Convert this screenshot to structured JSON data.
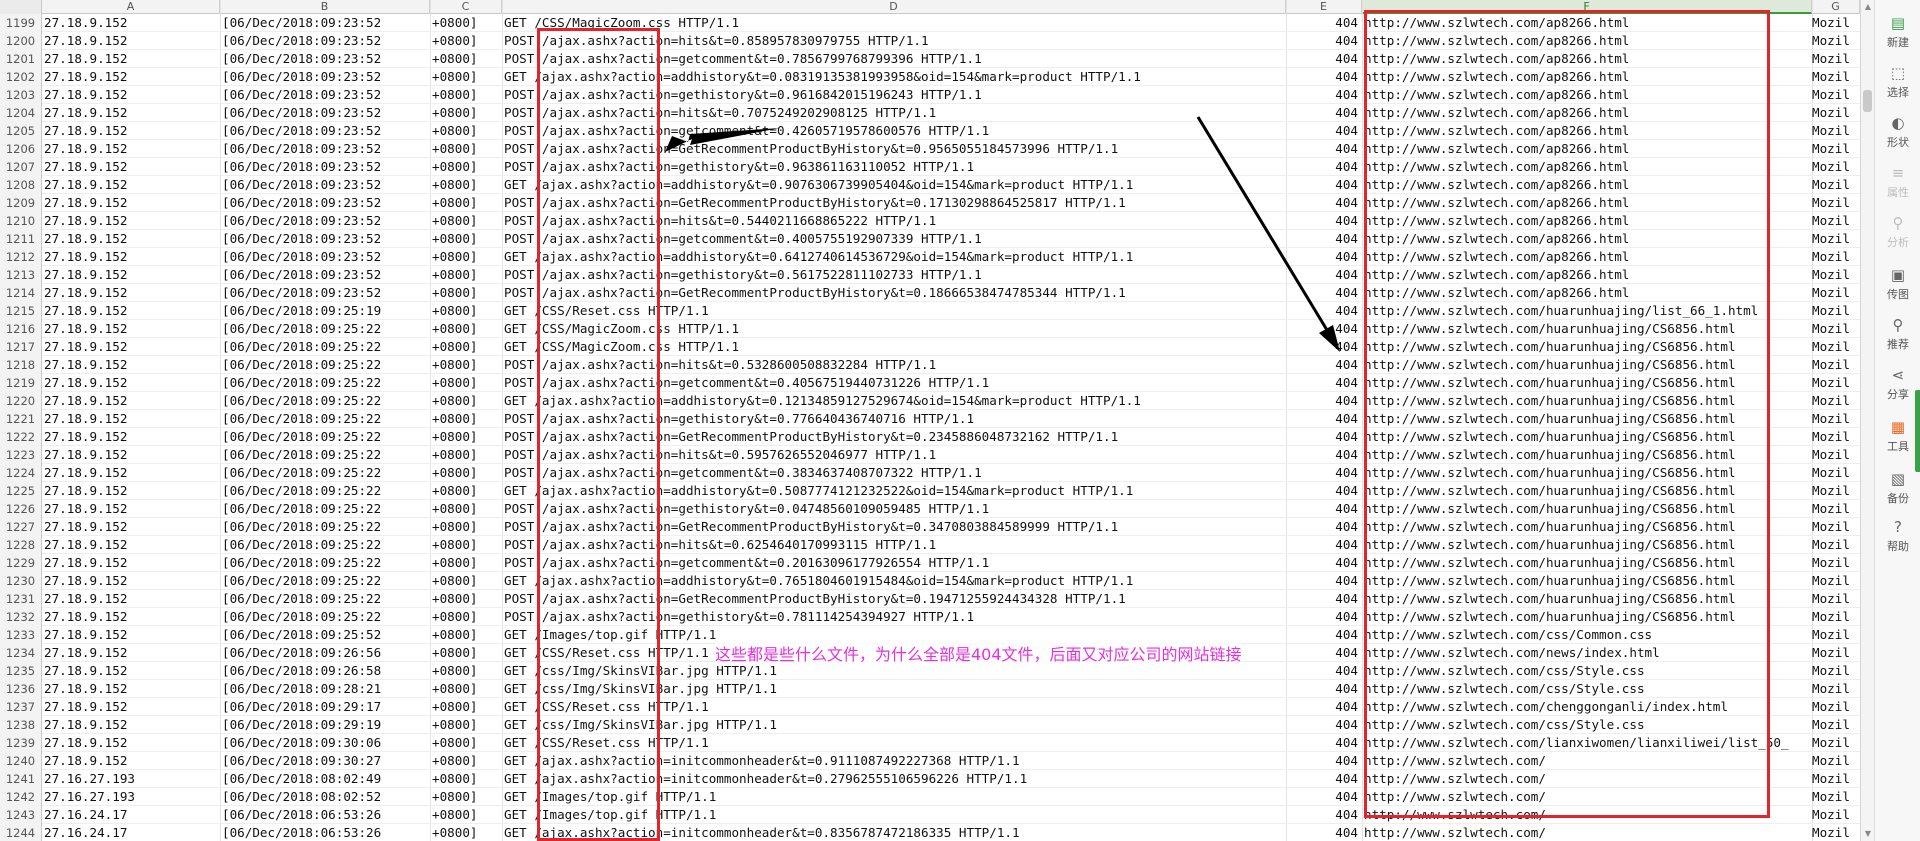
{
  "columns": [
    "A",
    "B",
    "C",
    "D",
    "E",
    "F",
    "G"
  ],
  "rows": [
    {
      "n": "1199",
      "a": "27.18.9.152",
      "b": "[06/Dec/2018:09:23:52",
      "c": "+0800]",
      "d": "GET /CSS/MagicZoom.css HTTP/1.1",
      "e": "404",
      "f": "http://www.szlwtech.com/ap8266.html",
      "g": "Mozil"
    },
    {
      "n": "1200",
      "a": "27.18.9.152",
      "b": "[06/Dec/2018:09:23:52",
      "c": "+0800]",
      "d": "POST /ajax.ashx?action=hits&t=0.858957830979755 HTTP/1.1",
      "e": "404",
      "f": "http://www.szlwtech.com/ap8266.html",
      "g": "Mozil"
    },
    {
      "n": "1201",
      "a": "27.18.9.152",
      "b": "[06/Dec/2018:09:23:52",
      "c": "+0800]",
      "d": "POST /ajax.ashx?action=getcomment&t=0.7856799768799396 HTTP/1.1",
      "e": "404",
      "f": "http://www.szlwtech.com/ap8266.html",
      "g": "Mozil"
    },
    {
      "n": "1202",
      "a": "27.18.9.152",
      "b": "[06/Dec/2018:09:23:52",
      "c": "+0800]",
      "d": "GET /ajax.ashx?action=addhistory&t=0.08319135381993958&oid=154&mark=product HTTP/1.1",
      "e": "404",
      "f": "http://www.szlwtech.com/ap8266.html",
      "g": "Mozil"
    },
    {
      "n": "1203",
      "a": "27.18.9.152",
      "b": "[06/Dec/2018:09:23:52",
      "c": "+0800]",
      "d": "POST /ajax.ashx?action=gethistory&t=0.9616842015196243 HTTP/1.1",
      "e": "404",
      "f": "http://www.szlwtech.com/ap8266.html",
      "g": "Mozil"
    },
    {
      "n": "1204",
      "a": "27.18.9.152",
      "b": "[06/Dec/2018:09:23:52",
      "c": "+0800]",
      "d": "POST /ajax.ashx?action=hits&t=0.7075249202908125 HTTP/1.1",
      "e": "404",
      "f": "http://www.szlwtech.com/ap8266.html",
      "g": "Mozil"
    },
    {
      "n": "1205",
      "a": "27.18.9.152",
      "b": "[06/Dec/2018:09:23:52",
      "c": "+0800]",
      "d": "POST /ajax.ashx?action=getcomment&t=0.42605719578600576 HTTP/1.1",
      "e": "404",
      "f": "http://www.szlwtech.com/ap8266.html",
      "g": "Mozil"
    },
    {
      "n": "1206",
      "a": "27.18.9.152",
      "b": "[06/Dec/2018:09:23:52",
      "c": "+0800]",
      "d": "POST /ajax.ashx?action=GetRecommentProductByHistory&t=0.9565055184573996 HTTP/1.1",
      "e": "404",
      "f": "http://www.szlwtech.com/ap8266.html",
      "g": "Mozil"
    },
    {
      "n": "1207",
      "a": "27.18.9.152",
      "b": "[06/Dec/2018:09:23:52",
      "c": "+0800]",
      "d": "POST /ajax.ashx?action=gethistory&t=0.963861163110052 HTTP/1.1",
      "e": "404",
      "f": "http://www.szlwtech.com/ap8266.html",
      "g": "Mozil"
    },
    {
      "n": "1208",
      "a": "27.18.9.152",
      "b": "[06/Dec/2018:09:23:52",
      "c": "+0800]",
      "d": "GET /ajax.ashx?action=addhistory&t=0.9076306739905404&oid=154&mark=product HTTP/1.1",
      "e": "404",
      "f": "http://www.szlwtech.com/ap8266.html",
      "g": "Mozil"
    },
    {
      "n": "1209",
      "a": "27.18.9.152",
      "b": "[06/Dec/2018:09:23:52",
      "c": "+0800]",
      "d": "POST /ajax.ashx?action=GetRecommentProductByHistory&t=0.17130298864525817 HTTP/1.1",
      "e": "404",
      "f": "http://www.szlwtech.com/ap8266.html",
      "g": "Mozil"
    },
    {
      "n": "1210",
      "a": "27.18.9.152",
      "b": "[06/Dec/2018:09:23:52",
      "c": "+0800]",
      "d": "POST /ajax.ashx?action=hits&t=0.5440211668865222 HTTP/1.1",
      "e": "404",
      "f": "http://www.szlwtech.com/ap8266.html",
      "g": "Mozil"
    },
    {
      "n": "1211",
      "a": "27.18.9.152",
      "b": "[06/Dec/2018:09:23:52",
      "c": "+0800]",
      "d": "POST /ajax.ashx?action=getcomment&t=0.4005755192907339 HTTP/1.1",
      "e": "404",
      "f": "http://www.szlwtech.com/ap8266.html",
      "g": "Mozil"
    },
    {
      "n": "1212",
      "a": "27.18.9.152",
      "b": "[06/Dec/2018:09:23:52",
      "c": "+0800]",
      "d": "GET /ajax.ashx?action=addhistory&t=0.6412740614536729&oid=154&mark=product HTTP/1.1",
      "e": "404",
      "f": "http://www.szlwtech.com/ap8266.html",
      "g": "Mozil"
    },
    {
      "n": "1213",
      "a": "27.18.9.152",
      "b": "[06/Dec/2018:09:23:52",
      "c": "+0800]",
      "d": "POST /ajax.ashx?action=gethistory&t=0.5617522811102733 HTTP/1.1",
      "e": "404",
      "f": "http://www.szlwtech.com/ap8266.html",
      "g": "Mozil"
    },
    {
      "n": "1214",
      "a": "27.18.9.152",
      "b": "[06/Dec/2018:09:23:52",
      "c": "+0800]",
      "d": "POST /ajax.ashx?action=GetRecommentProductByHistory&t=0.18666538474785344 HTTP/1.1",
      "e": "404",
      "f": "http://www.szlwtech.com/ap8266.html",
      "g": "Mozil"
    },
    {
      "n": "1215",
      "a": "27.18.9.152",
      "b": "[06/Dec/2018:09:25:19",
      "c": "+0800]",
      "d": "GET /CSS/Reset.css HTTP/1.1",
      "e": "404",
      "f": "http://www.szlwtech.com/huarunhuajing/list_66_1.html",
      "g": "Mozil"
    },
    {
      "n": "1216",
      "a": "27.18.9.152",
      "b": "[06/Dec/2018:09:25:22",
      "c": "+0800]",
      "d": "GET /CSS/MagicZoom.css HTTP/1.1",
      "e": "404",
      "f": "http://www.szlwtech.com/huarunhuajing/CS6856.html",
      "g": "Mozil"
    },
    {
      "n": "1217",
      "a": "27.18.9.152",
      "b": "[06/Dec/2018:09:25:22",
      "c": "+0800]",
      "d": "GET /CSS/MagicZoom.css HTTP/1.1",
      "e": "404",
      "f": "http://www.szlwtech.com/huarunhuajing/CS6856.html",
      "g": "Mozil"
    },
    {
      "n": "1218",
      "a": "27.18.9.152",
      "b": "[06/Dec/2018:09:25:22",
      "c": "+0800]",
      "d": "POST /ajax.ashx?action=hits&t=0.5328600508832284 HTTP/1.1",
      "e": "404",
      "f": "http://www.szlwtech.com/huarunhuajing/CS6856.html",
      "g": "Mozil"
    },
    {
      "n": "1219",
      "a": "27.18.9.152",
      "b": "[06/Dec/2018:09:25:22",
      "c": "+0800]",
      "d": "POST /ajax.ashx?action=getcomment&t=0.40567519440731226 HTTP/1.1",
      "e": "404",
      "f": "http://www.szlwtech.com/huarunhuajing/CS6856.html",
      "g": "Mozil"
    },
    {
      "n": "1220",
      "a": "27.18.9.152",
      "b": "[06/Dec/2018:09:25:22",
      "c": "+0800]",
      "d": "GET /ajax.ashx?action=addhistory&t=0.12134859127529674&oid=154&mark=product HTTP/1.1",
      "e": "404",
      "f": "http://www.szlwtech.com/huarunhuajing/CS6856.html",
      "g": "Mozil"
    },
    {
      "n": "1221",
      "a": "27.18.9.152",
      "b": "[06/Dec/2018:09:25:22",
      "c": "+0800]",
      "d": "POST /ajax.ashx?action=gethistory&t=0.776640436740716 HTTP/1.1",
      "e": "404",
      "f": "http://www.szlwtech.com/huarunhuajing/CS6856.html",
      "g": "Mozil"
    },
    {
      "n": "1222",
      "a": "27.18.9.152",
      "b": "[06/Dec/2018:09:25:22",
      "c": "+0800]",
      "d": "POST /ajax.ashx?action=GetRecommentProductByHistory&t=0.2345886048732162 HTTP/1.1",
      "e": "404",
      "f": "http://www.szlwtech.com/huarunhuajing/CS6856.html",
      "g": "Mozil"
    },
    {
      "n": "1223",
      "a": "27.18.9.152",
      "b": "[06/Dec/2018:09:25:22",
      "c": "+0800]",
      "d": "POST /ajax.ashx?action=hits&t=0.5957626552046977 HTTP/1.1",
      "e": "404",
      "f": "http://www.szlwtech.com/huarunhuajing/CS6856.html",
      "g": "Mozil"
    },
    {
      "n": "1224",
      "a": "27.18.9.152",
      "b": "[06/Dec/2018:09:25:22",
      "c": "+0800]",
      "d": "POST /ajax.ashx?action=getcomment&t=0.3834637408707322 HTTP/1.1",
      "e": "404",
      "f": "http://www.szlwtech.com/huarunhuajing/CS6856.html",
      "g": "Mozil"
    },
    {
      "n": "1225",
      "a": "27.18.9.152",
      "b": "[06/Dec/2018:09:25:22",
      "c": "+0800]",
      "d": "GET /ajax.ashx?action=addhistory&t=0.5087774121232522&oid=154&mark=product HTTP/1.1",
      "e": "404",
      "f": "http://www.szlwtech.com/huarunhuajing/CS6856.html",
      "g": "Mozil"
    },
    {
      "n": "1226",
      "a": "27.18.9.152",
      "b": "[06/Dec/2018:09:25:22",
      "c": "+0800]",
      "d": "POST /ajax.ashx?action=gethistory&t=0.04748560109059485 HTTP/1.1",
      "e": "404",
      "f": "http://www.szlwtech.com/huarunhuajing/CS6856.html",
      "g": "Mozil"
    },
    {
      "n": "1227",
      "a": "27.18.9.152",
      "b": "[06/Dec/2018:09:25:22",
      "c": "+0800]",
      "d": "POST /ajax.ashx?action=GetRecommentProductByHistory&t=0.3470803884589999 HTTP/1.1",
      "e": "404",
      "f": "http://www.szlwtech.com/huarunhuajing/CS6856.html",
      "g": "Mozil"
    },
    {
      "n": "1228",
      "a": "27.18.9.152",
      "b": "[06/Dec/2018:09:25:22",
      "c": "+0800]",
      "d": "POST /ajax.ashx?action=hits&t=0.6254640170993115 HTTP/1.1",
      "e": "404",
      "f": "http://www.szlwtech.com/huarunhuajing/CS6856.html",
      "g": "Mozil"
    },
    {
      "n": "1229",
      "a": "27.18.9.152",
      "b": "[06/Dec/2018:09:25:22",
      "c": "+0800]",
      "d": "POST /ajax.ashx?action=getcomment&t=0.20163096177926554 HTTP/1.1",
      "e": "404",
      "f": "http://www.szlwtech.com/huarunhuajing/CS6856.html",
      "g": "Mozil"
    },
    {
      "n": "1230",
      "a": "27.18.9.152",
      "b": "[06/Dec/2018:09:25:22",
      "c": "+0800]",
      "d": "GET /ajax.ashx?action=addhistory&t=0.7651804601915484&oid=154&mark=product HTTP/1.1",
      "e": "404",
      "f": "http://www.szlwtech.com/huarunhuajing/CS6856.html",
      "g": "Mozil"
    },
    {
      "n": "1231",
      "a": "27.18.9.152",
      "b": "[06/Dec/2018:09:25:22",
      "c": "+0800]",
      "d": "POST /ajax.ashx?action=GetRecommentProductByHistory&t=0.19471255924434328 HTTP/1.1",
      "e": "404",
      "f": "http://www.szlwtech.com/huarunhuajing/CS6856.html",
      "g": "Mozil"
    },
    {
      "n": "1232",
      "a": "27.18.9.152",
      "b": "[06/Dec/2018:09:25:22",
      "c": "+0800]",
      "d": "POST /ajax.ashx?action=gethistory&t=0.781114254394927 HTTP/1.1",
      "e": "404",
      "f": "http://www.szlwtech.com/huarunhuajing/CS6856.html",
      "g": "Mozil"
    },
    {
      "n": "1233",
      "a": "27.18.9.152",
      "b": "[06/Dec/2018:09:25:52",
      "c": "+0800]",
      "d": "GET /Images/top.gif HTTP/1.1",
      "e": "404",
      "f": "http://www.szlwtech.com/css/Common.css",
      "g": "Mozil"
    },
    {
      "n": "1234",
      "a": "27.18.9.152",
      "b": "[06/Dec/2018:09:26:56",
      "c": "+0800]",
      "d": "GET /CSS/Reset.css HTTP/1.1",
      "e": "404",
      "f": "http://www.szlwtech.com/news/index.html",
      "g": "Mozil"
    },
    {
      "n": "1235",
      "a": "27.18.9.152",
      "b": "[06/Dec/2018:09:26:58",
      "c": "+0800]",
      "d": "GET /css/Img/SkinsVIBar.jpg HTTP/1.1",
      "e": "404",
      "f": "http://www.szlwtech.com/css/Style.css",
      "g": "Mozil"
    },
    {
      "n": "1236",
      "a": "27.18.9.152",
      "b": "[06/Dec/2018:09:28:21",
      "c": "+0800]",
      "d": "GET /css/Img/SkinsVIBar.jpg HTTP/1.1",
      "e": "404",
      "f": "http://www.szlwtech.com/css/Style.css",
      "g": "Mozil"
    },
    {
      "n": "1237",
      "a": "27.18.9.152",
      "b": "[06/Dec/2018:09:29:17",
      "c": "+0800]",
      "d": "GET /CSS/Reset.css HTTP/1.1",
      "e": "404",
      "f": "http://www.szlwtech.com/chenggonganli/index.html",
      "g": "Mozil"
    },
    {
      "n": "1238",
      "a": "27.18.9.152",
      "b": "[06/Dec/2018:09:29:19",
      "c": "+0800]",
      "d": "GET /css/Img/SkinsVIBar.jpg HTTP/1.1",
      "e": "404",
      "f": "http://www.szlwtech.com/css/Style.css",
      "g": "Mozil"
    },
    {
      "n": "1239",
      "a": "27.18.9.152",
      "b": "[06/Dec/2018:09:30:06",
      "c": "+0800]",
      "d": "GET /CSS/Reset.css HTTP/1.1",
      "e": "404",
      "f": "http://www.szlwtech.com/lianxiwomen/lianxiliwei/list_50_",
      "g": "Mozil"
    },
    {
      "n": "1240",
      "a": "27.18.9.152",
      "b": "[06/Dec/2018:09:30:27",
      "c": "+0800]",
      "d": "GET /ajax.ashx?action=initcommonheader&t=0.9111087492227368 HTTP/1.1",
      "e": "404",
      "f": "http://www.szlwtech.com/",
      "g": "Mozil"
    },
    {
      "n": "1241",
      "a": "27.16.27.193",
      "b": "[06/Dec/2018:08:02:49",
      "c": "+0800]",
      "d": "GET /ajax.ashx?action=initcommonheader&t=0.27962555106596226 HTTP/1.1",
      "e": "404",
      "f": "http://www.szlwtech.com/",
      "g": "Mozil"
    },
    {
      "n": "1242",
      "a": "27.16.27.193",
      "b": "[06/Dec/2018:08:02:52",
      "c": "+0800]",
      "d": "GET /Images/top.gif HTTP/1.1",
      "e": "404",
      "f": "http://www.szlwtech.com/",
      "g": "Mozil"
    },
    {
      "n": "1243",
      "a": "27.16.24.17",
      "b": "[06/Dec/2018:06:53:26",
      "c": "+0800]",
      "d": "GET /Images/top.gif HTTP/1.1",
      "e": "404",
      "f": "http://www.szlwtech.com/",
      "g": "Mozil"
    },
    {
      "n": "1244",
      "a": "27.16.24.17",
      "b": "[06/Dec/2018:06:53:26",
      "c": "+0800]",
      "d": "GET /ajax.ashx?action=initcommonheader&t=0.8356787472186335 HTTP/1.1",
      "e": "404",
      "f": "http://www.szlwtech.com/",
      "g": "Mozil"
    }
  ],
  "annotation": "这些都是些什么文件，为什么全部是404文件，后面又对应公司的网站链接",
  "annotation_color": "#e52fe0",
  "highlight_color": "#e0262c",
  "sidebar": [
    {
      "icon": "new-doc-icon",
      "glyph": "▤",
      "label": "新建",
      "disabled": false
    },
    {
      "icon": "select-icon",
      "glyph": "⬚",
      "label": "选择",
      "disabled": false
    },
    {
      "icon": "shape-icon",
      "glyph": "◐",
      "label": "形状",
      "disabled": false
    },
    {
      "icon": "properties-icon",
      "glyph": "≡",
      "label": "属性",
      "disabled": true
    },
    {
      "icon": "analysis-icon",
      "glyph": "⚲",
      "label": "分析",
      "disabled": true
    },
    {
      "icon": "image-icon",
      "glyph": "▣",
      "label": "传图",
      "disabled": false
    },
    {
      "icon": "recommend-icon",
      "glyph": "⚲",
      "label": "推荐",
      "disabled": false
    },
    {
      "icon": "share-icon",
      "glyph": "⋖",
      "label": "分享",
      "disabled": false
    },
    {
      "icon": "toolbox-icon",
      "glyph": "▦",
      "label": "工具",
      "disabled": false
    },
    {
      "icon": "backup-icon",
      "glyph": "▧",
      "label": "备份",
      "disabled": false
    },
    {
      "icon": "help-icon",
      "glyph": "?",
      "label": "帮助",
      "disabled": false
    }
  ]
}
